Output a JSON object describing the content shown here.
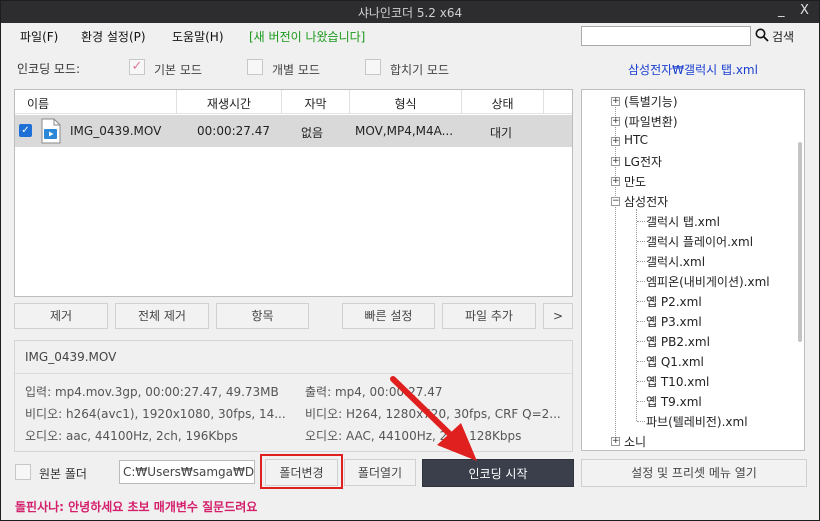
{
  "titlebar": {
    "title": "샤나인코더  5.2  x64",
    "minimize": "_",
    "close": "X"
  },
  "menu": {
    "file": "파일(F)",
    "settings": "환경 설정(P)",
    "help": "도움말(H)",
    "new_version": "[새 버전이 나왔습니다]"
  },
  "search": {
    "value": "",
    "label": "검색"
  },
  "modes": {
    "label": "인코딩 모드:",
    "basic": "기본 모드",
    "individual": "개별 모드",
    "merge": "합치기 모드"
  },
  "preset": {
    "name": "삼성전자₩갤럭시 탭.xml"
  },
  "filelist": {
    "columns": [
      "이름",
      "재생시간",
      "자막",
      "형식",
      "상태"
    ],
    "rows": [
      {
        "name": "IMG_0439.MOV",
        "duration": "00:00:27.47",
        "subtitle": "없음",
        "format": "MOV,MP4,M4A...",
        "status": "대기"
      }
    ]
  },
  "buttons": {
    "remove": "제거",
    "remove_all": "전체 제거",
    "items": "항목",
    "quick_settings": "빠른 설정",
    "add_file": "파일 추가",
    "more": ">"
  },
  "info": {
    "filename": "IMG_0439.MOV",
    "input": "입력: mp4.mov.3gp, 00:00:27.47, 49.73MB",
    "video_in": "비디오: h264(avc1), 1920x1080, 30fps, 14...",
    "audio_in": "오디오: aac, 44100Hz, 2ch, 196Kbps",
    "output": "출력: mp4, 00:00:27.47",
    "video_out": "비디오: H264, 1280x720, 30fps, CRF Q=2...",
    "audio_out": "오디오: AAC, 44100Hz, 2ch, 128Kbps"
  },
  "tree": {
    "top": [
      "(특별기능)",
      "(파일변환)",
      "HTC",
      "LG전자",
      "만도"
    ],
    "samsung": "삼성전자",
    "children": [
      "갤럭시 탭.xml",
      "갤럭시 플레이어.xml",
      "갤럭시.xml",
      "엠피온(내비게이션).xml",
      "옙 P2.xml",
      "옙 P3.xml",
      "옙 PB2.xml",
      "옙 Q1.xml",
      "옙 T10.xml",
      "옙 T9.xml",
      "파브(텔레비전).xml"
    ],
    "after": "소니"
  },
  "bottom": {
    "source_folder": "원본 폴더",
    "path": "C:₩Users₩samga₩De",
    "change_folder": "폴더변경",
    "open_folder": "폴더열기",
    "start": "인코딩 시작",
    "preset_menu": "설정 및 프리셋 메뉴 열기"
  },
  "status": {
    "message": "돌핀사나: 안녕하세요 초보 매개변수 질문드려요"
  },
  "colors": {
    "accent_red": "#e0201e",
    "link_blue": "#1a3fcf",
    "status_pink": "#d4206c",
    "new_green": "#1a9a1a"
  }
}
